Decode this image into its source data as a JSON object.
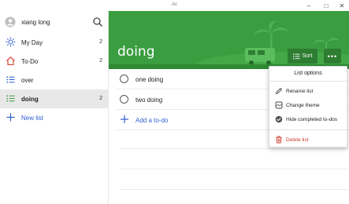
{
  "window": {
    "title": "Ac",
    "minimize_glyph": "–",
    "maximize_glyph": "□",
    "close_glyph": "✕"
  },
  "sidebar": {
    "user_name": "xiang long",
    "items": [
      {
        "label": "My Day",
        "count": "2",
        "icon": "sun-icon"
      },
      {
        "label": "To-Do",
        "count": "2",
        "icon": "home-icon"
      },
      {
        "label": "over",
        "count": "",
        "icon": "list-icon"
      },
      {
        "label": "doing",
        "count": "2",
        "icon": "list-icon"
      }
    ],
    "new_list_label": "New list"
  },
  "main": {
    "list_title": "doing",
    "sort_label": "Sort",
    "more_glyph": "•••",
    "tasks": [
      {
        "title": "one doing"
      },
      {
        "title": "two doing"
      }
    ],
    "add_todo_label": "Add a to-do"
  },
  "list_options_menu": {
    "title": "List options",
    "items": [
      {
        "label": "Rename list",
        "icon": "pencil-icon"
      },
      {
        "label": "Change theme",
        "icon": "palette-icon"
      },
      {
        "label": "Hide completed to-dos",
        "icon": "check-circle-icon"
      },
      {
        "label": "Delete list",
        "icon": "trash-icon"
      }
    ]
  },
  "colors": {
    "accent_blue": "#2f5fd0",
    "banner_green": "#3a9d3f",
    "button_green": "#2e7d32",
    "danger_red": "#d23a2c",
    "active_row": "#e8e8e8"
  }
}
